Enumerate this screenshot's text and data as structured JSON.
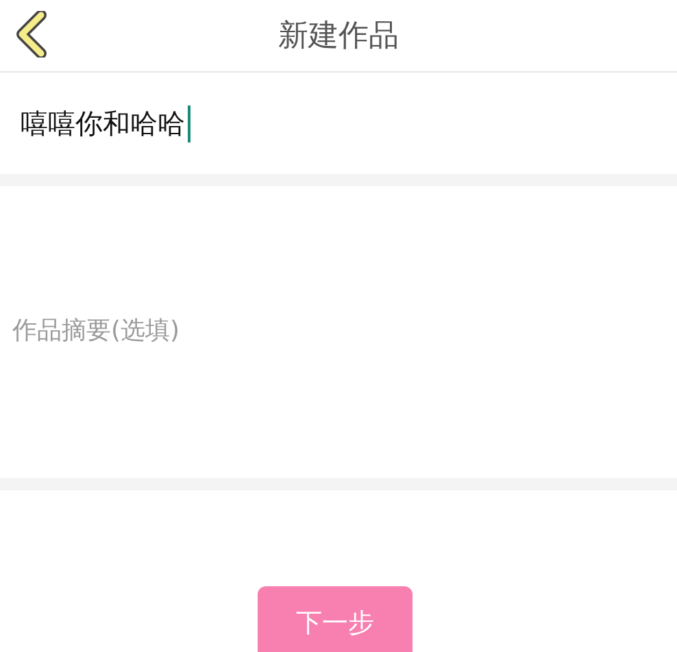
{
  "header": {
    "title": "新建作品"
  },
  "title_field": {
    "value": "嘻嘻你和哈哈",
    "focused": true
  },
  "summary_field": {
    "placeholder": "作品摘要(选填)"
  },
  "next_button": {
    "label": "下一步"
  }
}
